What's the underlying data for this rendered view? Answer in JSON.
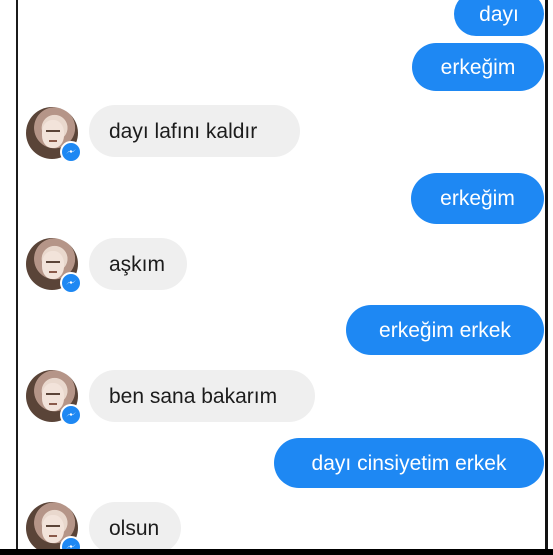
{
  "messages": [
    {
      "side": "sent",
      "text": "dayı"
    },
    {
      "side": "sent",
      "text": "erkeğim"
    },
    {
      "side": "received",
      "text": "dayı  lafını  kaldır"
    },
    {
      "side": "sent",
      "text": "erkeğim"
    },
    {
      "side": "received",
      "text": "aşkım"
    },
    {
      "side": "sent",
      "text": "erkeğim erkek"
    },
    {
      "side": "received",
      "text": "ben  sana  bakarım"
    },
    {
      "side": "sent",
      "text": "dayı cinsiyetim erkek"
    },
    {
      "side": "received",
      "text": "olsun"
    }
  ],
  "contact": {
    "avatar_icon": "contact-avatar",
    "badge_icon": "messenger-icon"
  },
  "colors": {
    "sent_bubble": "#1e88f3",
    "received_bubble": "#efefef",
    "sent_text": "#ffffff",
    "received_text": "#1c1c1c"
  }
}
